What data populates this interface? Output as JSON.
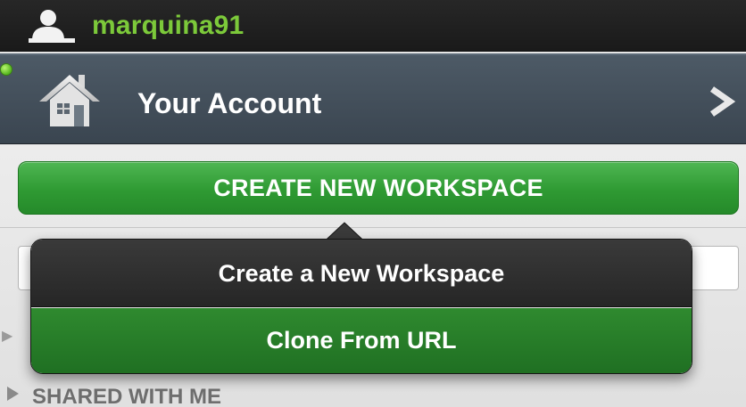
{
  "user": {
    "username": "marquina91",
    "icon": "user-icon"
  },
  "account": {
    "label": "Your Account",
    "icon": "home-icon",
    "status_icon": "online-status-dot",
    "nav_icon": "chevron-right-icon"
  },
  "sidebar": {
    "create_button_label": "CREATE NEW WORKSPACE",
    "search_placeholder": "",
    "shared_section_label": "SHARED WITH ME",
    "shared_section_icon": "triangle-right-icon"
  },
  "popup_menu": {
    "items": [
      {
        "label": "Create a New Workspace"
      },
      {
        "label": "Clone From URL"
      }
    ]
  },
  "colors": {
    "username": "#7cc93a",
    "create_button": "#2f9a33",
    "clone_item": "#1f6f22",
    "popup_dark": "#262626",
    "account_bar": "#3a4550"
  }
}
